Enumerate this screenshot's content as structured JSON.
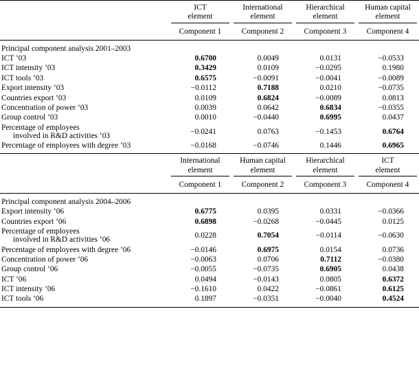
{
  "document": {
    "type": "principal-component-analysis-table"
  },
  "table1": {
    "group_headers": [
      {
        "line1": "ICT",
        "line2": "element"
      },
      {
        "line1": "International",
        "line2": "element"
      },
      {
        "line1": "Hierarchical",
        "line2": "element"
      },
      {
        "line1": "Human capital",
        "line2": "element"
      }
    ],
    "component_headers": [
      "Component 1",
      "Component 2",
      "Component 3",
      "Component 4"
    ],
    "section_title": "Principal component analysis 2001–2003",
    "rows": [
      {
        "label": "ICT ’03",
        "label_cont": "",
        "values": [
          "0.6700",
          "0.0049",
          "0.0131",
          "−0.0533"
        ],
        "bold": [
          true,
          false,
          false,
          false
        ]
      },
      {
        "label": "ICT intensity ’03",
        "label_cont": "",
        "values": [
          "0.3429",
          "0.0109",
          "−0.0295",
          "0.1980"
        ],
        "bold": [
          true,
          false,
          false,
          false
        ]
      },
      {
        "label": "ICT tools ’03",
        "label_cont": "",
        "values": [
          "0.6575",
          "−0.0091",
          "−0.0041",
          "−0.0089"
        ],
        "bold": [
          true,
          false,
          false,
          false
        ]
      },
      {
        "label": "Export intensity ’03",
        "label_cont": "",
        "values": [
          "−0.0112",
          "0.7188",
          "0.0210",
          "−0.0735"
        ],
        "bold": [
          false,
          true,
          false,
          false
        ]
      },
      {
        "label": "Countries export ’03",
        "label_cont": "",
        "values": [
          "0.0109",
          "0.6824",
          "−0.0089",
          "0.0813"
        ],
        "bold": [
          false,
          true,
          false,
          false
        ]
      },
      {
        "label": "Concentration of power ’03",
        "label_cont": "",
        "values": [
          "0.0039",
          "0.0642",
          "0.6834",
          "−0.0355"
        ],
        "bold": [
          false,
          false,
          true,
          false
        ]
      },
      {
        "label": "Group control ’03",
        "label_cont": "",
        "values": [
          "0.0010",
          "−0.0440",
          "0.6995",
          "0.0437"
        ],
        "bold": [
          false,
          false,
          true,
          false
        ]
      },
      {
        "label": "Percentage of employees",
        "label_cont": "involved in R&D activities ’03",
        "values": [
          "−0.0241",
          "0.0763",
          "−0.1453",
          "0.6764"
        ],
        "bold": [
          false,
          false,
          false,
          true
        ]
      },
      {
        "label": "Percentage of employees with degree ’03",
        "label_cont": "",
        "values": [
          "−0.0168",
          "−0.0746",
          "0.1446",
          "0.6965"
        ],
        "bold": [
          false,
          false,
          false,
          true
        ]
      }
    ]
  },
  "table2": {
    "group_headers": [
      {
        "line1": "International",
        "line2": "element"
      },
      {
        "line1": "Human capital",
        "line2": "element"
      },
      {
        "line1": "Hierarchical",
        "line2": "element"
      },
      {
        "line1": "ICT",
        "line2": "element"
      }
    ],
    "component_headers": [
      "Component 1",
      "Component 2",
      "Component 3",
      "Component 4"
    ],
    "section_title": "Principal component analysis 2004–2006",
    "rows": [
      {
        "label": "Export intensity ’06",
        "label_cont": "",
        "values": [
          "0.6775",
          "0.0395",
          "0.0331",
          "−0.0366"
        ],
        "bold": [
          true,
          false,
          false,
          false
        ]
      },
      {
        "label": "Countries export ’06",
        "label_cont": "",
        "values": [
          "0.6898",
          "−0.0268",
          "−0.0445",
          "0.0125"
        ],
        "bold": [
          true,
          false,
          false,
          false
        ]
      },
      {
        "label": "Percentage of employees",
        "label_cont": "involved in R&D activities ’06",
        "values": [
          "0.0228",
          "0.7054",
          "−0.0114",
          "−0.0630"
        ],
        "bold": [
          false,
          true,
          false,
          false
        ]
      },
      {
        "label": "Percentage of employees with degree ’06",
        "label_cont": "",
        "values": [
          "−0.0146",
          "0.6975",
          "0.0154",
          "0.0736"
        ],
        "bold": [
          false,
          true,
          false,
          false
        ]
      },
      {
        "label": "Concentration of power ’06",
        "label_cont": "",
        "values": [
          "−0.0063",
          "0.0706",
          "0.7112",
          "−0.0380"
        ],
        "bold": [
          false,
          false,
          true,
          false
        ]
      },
      {
        "label": "Group control ’06",
        "label_cont": "",
        "values": [
          "−0.0055",
          "−0.0735",
          "0.6905",
          "0.0438"
        ],
        "bold": [
          false,
          false,
          true,
          false
        ]
      },
      {
        "label": "ICT ’06",
        "label_cont": "",
        "values": [
          "0.0494",
          "−0.0143",
          "0.0805",
          "0.6372"
        ],
        "bold": [
          false,
          false,
          false,
          true
        ]
      },
      {
        "label": "ICT intensity ’06",
        "label_cont": "",
        "values": [
          "−0.1610",
          "0.0422",
          "−0.0861",
          "0.6125"
        ],
        "bold": [
          false,
          false,
          false,
          true
        ]
      },
      {
        "label": "ICT tools ’06",
        "label_cont": "",
        "values": [
          "0.1897",
          "−0.0351",
          "−0.0040",
          "0.4524"
        ],
        "bold": [
          false,
          false,
          false,
          true
        ]
      }
    ]
  }
}
